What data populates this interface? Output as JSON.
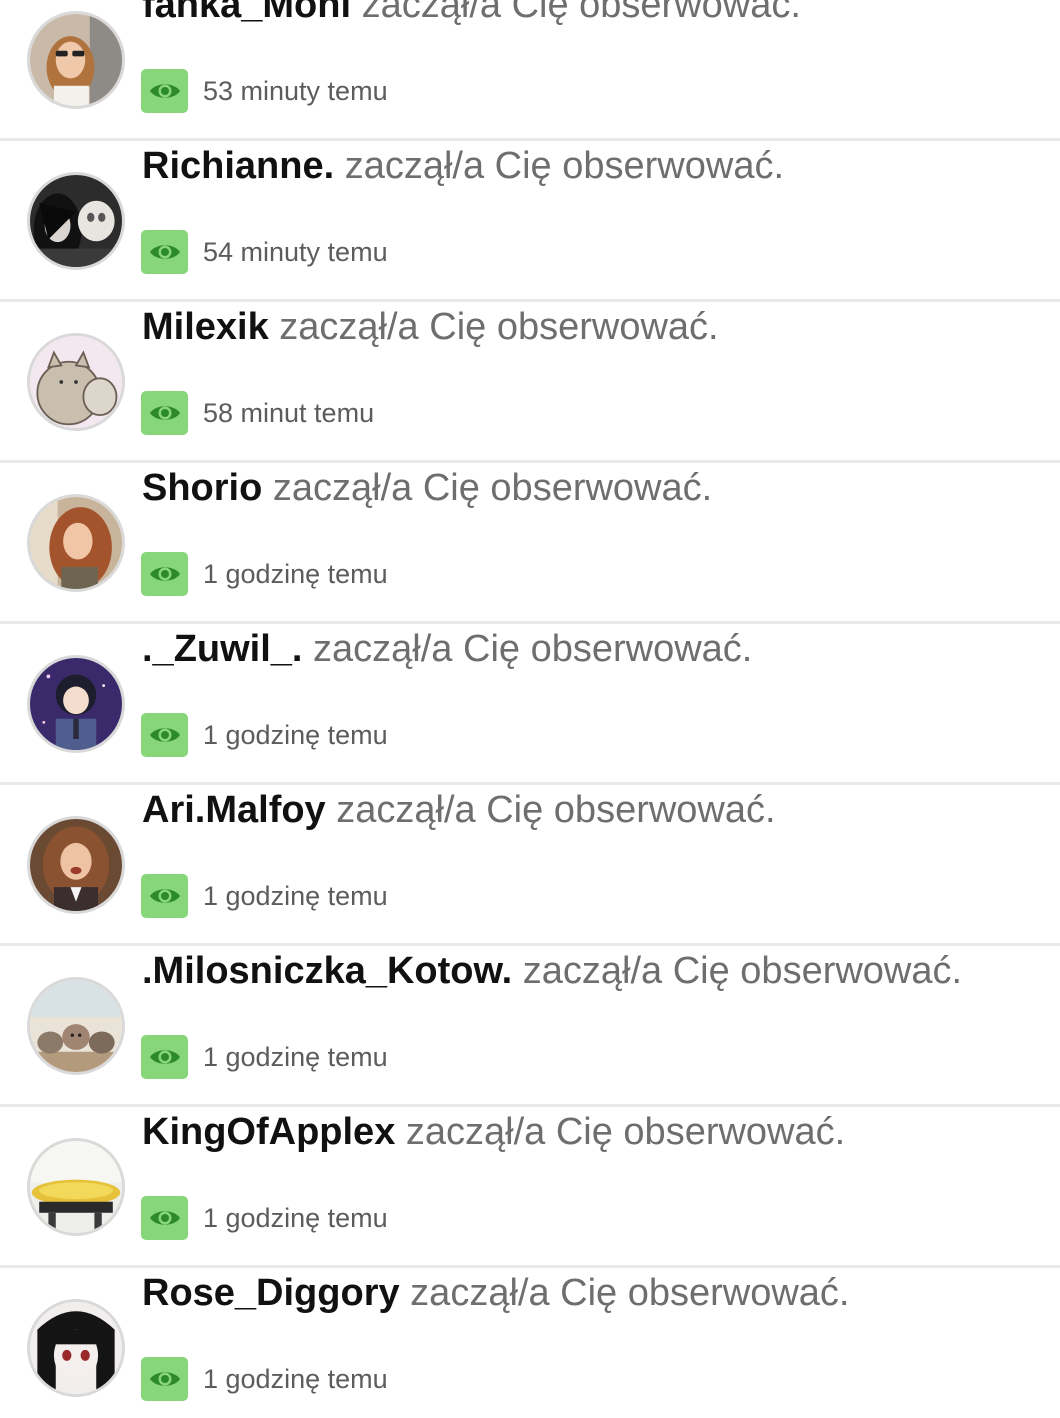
{
  "notifications": [
    {
      "username": "fanka_Moni",
      "action": " zaczął/a Cię obserwować.",
      "time": "53 minuty temu",
      "avatar": "avatar-girl-sunglasses"
    },
    {
      "username": "Richianne.",
      "action": " zaczął/a Cię obserwować.",
      "time": "54 minuty temu",
      "avatar": "avatar-dark-anime"
    },
    {
      "username": "Milexik",
      "action": " zaczął/a Cię obserwować.",
      "time": "58 minut temu",
      "avatar": "avatar-pusheen-cats"
    },
    {
      "username": "Shorio",
      "action": " zaczął/a Cię obserwować.",
      "time": "1 godzinę temu",
      "avatar": "avatar-redhead-girl"
    },
    {
      "username": "._Zuwil_.",
      "action": " zaczął/a Cię obserwować.",
      "time": "1 godzinę temu",
      "avatar": "avatar-anime-boy-galaxy"
    },
    {
      "username": "Ari.Malfoy",
      "action": " zaczął/a Cię obserwować.",
      "time": "1 godzinę temu",
      "avatar": "avatar-hermione"
    },
    {
      "username": ".Milosniczka_Kotow.",
      "action": " zaczął/a Cię obserwować.",
      "time": "1 godzinę temu",
      "avatar": "avatar-kittens"
    },
    {
      "username": "KingOfApplex",
      "action": " zaczął/a Cię obserwować.",
      "time": "1 godzinę temu",
      "avatar": "avatar-food-plate"
    },
    {
      "username": "Rose_Diggory",
      "action": " zaczął/a Cię obserwować.",
      "time": "1 godzinę temu",
      "avatar": "avatar-anime-girl-bangs"
    }
  ],
  "theme": {
    "accent": "#88d67a",
    "eye_icon_color": "#2d8a2a",
    "username_color": "#111111",
    "action_color": "#6e6e6e",
    "separator": "#e9e9e9"
  },
  "icons": {
    "seen": "eye-icon"
  }
}
